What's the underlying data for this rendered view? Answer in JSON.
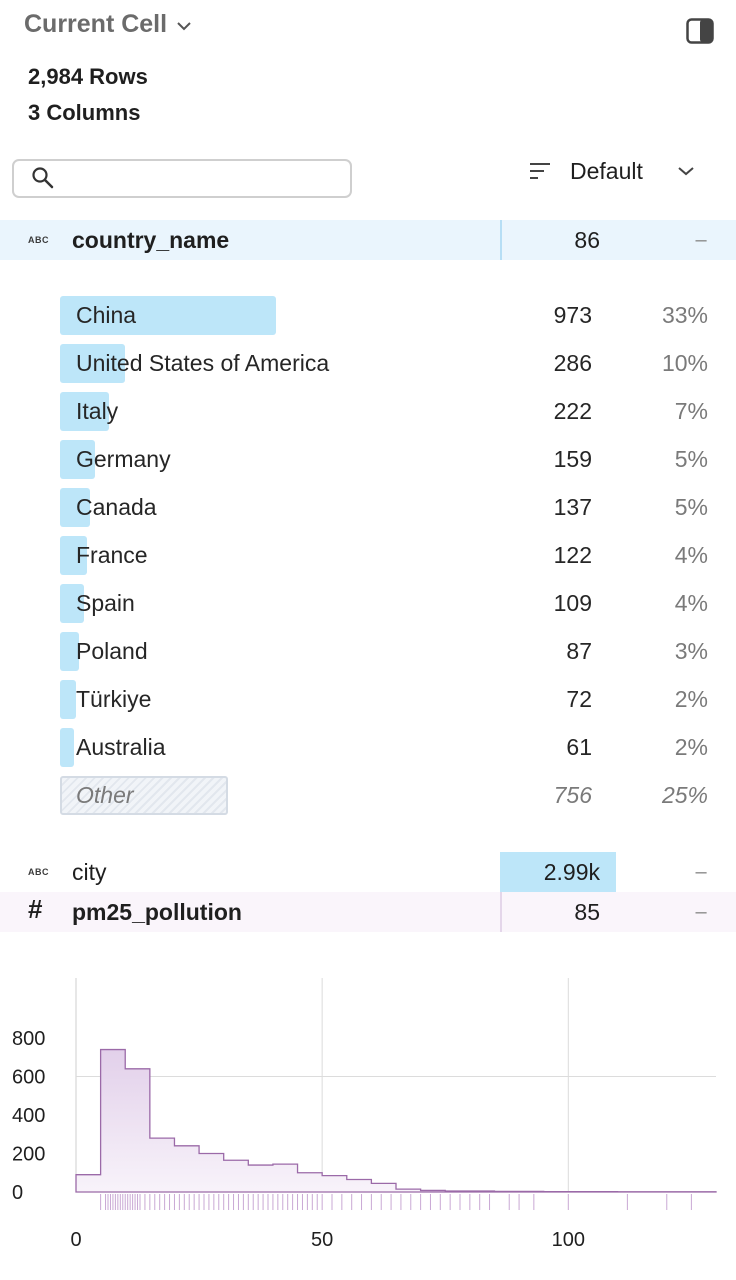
{
  "header": {
    "title": "Current Cell"
  },
  "summary": {
    "rows": "2,984 Rows",
    "columns": "3 Columns"
  },
  "search": {
    "placeholder": "",
    "value": ""
  },
  "sort": {
    "label": "Default"
  },
  "columns": [
    {
      "name": "country_name",
      "type": "ABC",
      "count": "86",
      "dash": "–"
    },
    {
      "name": "city",
      "type": "ABC",
      "count": "2.99k",
      "dash": "–"
    },
    {
      "name": "pm25_pollution",
      "type": "#",
      "count": "85",
      "dash": "–"
    }
  ],
  "country_values": [
    {
      "label": "China",
      "count": "973",
      "pct": "33%",
      "share": 0.33
    },
    {
      "label": "United States of America",
      "count": "286",
      "pct": "10%",
      "share": 0.1
    },
    {
      "label": "Italy",
      "count": "222",
      "pct": "7%",
      "share": 0.075
    },
    {
      "label": "Germany",
      "count": "159",
      "pct": "5%",
      "share": 0.053
    },
    {
      "label": "Canada",
      "count": "137",
      "pct": "5%",
      "share": 0.046
    },
    {
      "label": "France",
      "count": "122",
      "pct": "4%",
      "share": 0.041
    },
    {
      "label": "Spain",
      "count": "109",
      "pct": "4%",
      "share": 0.037
    },
    {
      "label": "Poland",
      "count": "87",
      "pct": "3%",
      "share": 0.029
    },
    {
      "label": "Türkiye",
      "count": "72",
      "pct": "2%",
      "share": 0.024
    },
    {
      "label": "Australia",
      "count": "61",
      "pct": "2%",
      "share": 0.02
    }
  ],
  "country_other": {
    "label": "Other",
    "count": "756",
    "pct": "25%",
    "share": 0.25
  },
  "colors": {
    "bar": "#bde6f9",
    "selected_row": "#eaf5fd",
    "histogram_stroke": "#9b6aa8",
    "histogram_fill_top": "#e2d0ea",
    "histogram_fill_bottom": "#f8f3fa"
  },
  "chart_data": {
    "type": "histogram",
    "bin_width": 5,
    "x": [
      0,
      5,
      10,
      15,
      20,
      25,
      30,
      35,
      40,
      45,
      50,
      55,
      60,
      65,
      70,
      75,
      80,
      85,
      90,
      95,
      100,
      105,
      110,
      115,
      120,
      125,
      130
    ],
    "values": [
      90,
      740,
      640,
      280,
      240,
      200,
      165,
      140,
      145,
      100,
      85,
      65,
      45,
      15,
      8,
      5,
      5,
      3,
      3,
      2,
      2,
      2,
      1,
      1,
      1,
      1
    ],
    "xlim": [
      0,
      130
    ],
    "ylim": [
      0,
      800
    ],
    "xticks": [
      "0",
      "50",
      "100"
    ],
    "yticks": [
      "0",
      "200",
      "400",
      "600",
      "800"
    ],
    "rug": [
      5,
      6,
      6.5,
      7,
      7.5,
      8,
      8.5,
      9,
      9.5,
      10,
      10.5,
      11,
      11.5,
      12,
      12.5,
      13,
      14,
      15,
      16,
      17,
      18,
      19,
      20,
      21,
      22,
      23,
      24,
      25,
      26,
      27,
      28,
      29,
      30,
      31,
      32,
      33,
      34,
      35,
      36,
      37,
      38,
      39,
      40,
      41,
      42,
      43,
      44,
      45,
      46,
      47,
      48,
      49,
      50,
      52,
      54,
      56,
      58,
      60,
      62,
      64,
      66,
      68,
      70,
      72,
      74,
      76,
      78,
      80,
      82,
      84,
      88,
      90,
      93,
      100,
      112,
      120,
      125
    ],
    "grid": true
  }
}
